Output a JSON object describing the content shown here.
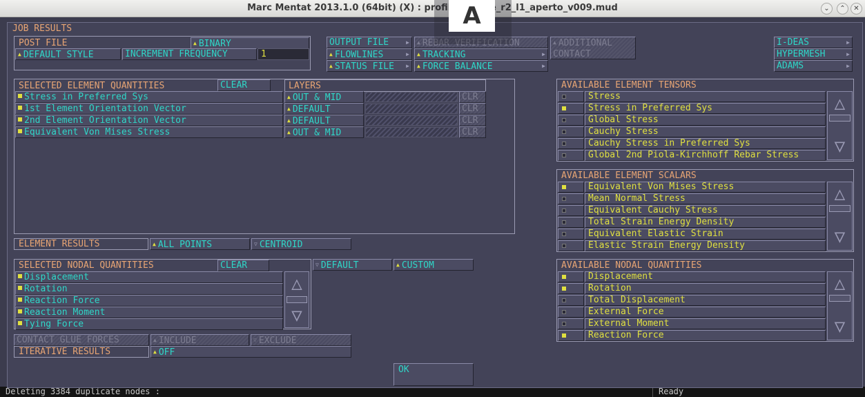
{
  "window": {
    "title": "Marc Mentat 2013.1.0 (64bit) (X) : profilato_a… e_r2_l1_aperto_v009.mud",
    "overlay_letter": "A"
  },
  "dialog": {
    "title": "JOB RESULTS",
    "post_file": {
      "label": "POST FILE",
      "format": "BINARY",
      "default_style": "DEFAULT STYLE",
      "increment_frequency_label": "INCREMENT FREQUENCY",
      "increment_frequency_value": "1"
    },
    "buttons": {
      "output_file": "OUTPUT FILE",
      "flowlines": "FLOWLINES",
      "status_file": "STATUS FILE",
      "rebar_verification": "REBAR VERIFICATION",
      "tracking": "TRACKING",
      "force_balance": "FORCE BALANCE",
      "additional_contact": "ADDITIONAL CONTACT",
      "ideas": "I-DEAS",
      "hypermesh": "HYPERMESH",
      "adams": "ADAMS"
    },
    "selected_element": {
      "label": "SELECTED ELEMENT QUANTITIES",
      "clear": "CLEAR",
      "layers_label": "LAYERS",
      "rows": [
        {
          "name": "Stress in Preferred Sys",
          "layer": "OUT & MID",
          "clr": "CLR"
        },
        {
          "name": "1st Element Orientation Vector",
          "layer": "DEFAULT",
          "clr": "CLR"
        },
        {
          "name": "2nd Element Orientation Vector",
          "layer": "DEFAULT",
          "clr": "CLR"
        },
        {
          "name": "Equivalent Von Mises Stress",
          "layer": "OUT & MID",
          "clr": "CLR"
        }
      ]
    },
    "element_results": {
      "label": "ELEMENT RESULTS",
      "all_points": "ALL POINTS",
      "centroid": "CENTROID"
    },
    "selected_nodal": {
      "label": "SELECTED NODAL QUANTITIES",
      "clear": "CLEAR",
      "default": "DEFAULT",
      "custom": "CUSTOM",
      "items": [
        "Displacement",
        "Rotation",
        "Reaction Force",
        "Reaction Moment",
        "Tying Force"
      ]
    },
    "contact_glue": {
      "label": "CONTACT GLUE FORCES",
      "include": "INCLUDE",
      "exclude": "EXCLUDE"
    },
    "iterative": {
      "label": "ITERATIVE RESULTS",
      "value": "OFF"
    },
    "ok": "OK",
    "tensors": {
      "label": "AVAILABLE ELEMENT TENSORS",
      "items": [
        {
          "name": "Stress",
          "on": false
        },
        {
          "name": "Stress in Preferred Sys",
          "on": true
        },
        {
          "name": "Global Stress",
          "on": false
        },
        {
          "name": "Cauchy Stress",
          "on": false
        },
        {
          "name": "Cauchy Stress in Preferred Sys",
          "on": false
        },
        {
          "name": "Global 2nd Piola-Kirchhoff Rebar Stress",
          "on": false
        }
      ]
    },
    "scalars": {
      "label": "AVAILABLE ELEMENT SCALARS",
      "items": [
        {
          "name": "Equivalent Von Mises Stress",
          "on": true
        },
        {
          "name": "Mean Normal Stress",
          "on": false
        },
        {
          "name": "Equivalent Cauchy Stress",
          "on": false
        },
        {
          "name": "Total Strain Energy Density",
          "on": false
        },
        {
          "name": "Equivalent Elastic Strain",
          "on": false
        },
        {
          "name": "Elastic Strain Energy Density",
          "on": false
        }
      ]
    },
    "nodal": {
      "label": "AVAILABLE NODAL QUANTITIES",
      "items": [
        {
          "name": "Displacement",
          "on": true
        },
        {
          "name": "Rotation",
          "on": true
        },
        {
          "name": "Total Displacement",
          "on": false
        },
        {
          "name": "External Force",
          "on": false
        },
        {
          "name": "External Moment",
          "on": false
        },
        {
          "name": "Reaction Force",
          "on": true
        }
      ]
    }
  },
  "console": {
    "left": "Deleting 3384 duplicate nodes :",
    "right": "Ready"
  },
  "colors": {
    "label": "#e8a574",
    "button_text": "#2fd7c8",
    "list_text": "#e0e040",
    "panel": "#434358",
    "border": "#9c9cb4"
  }
}
